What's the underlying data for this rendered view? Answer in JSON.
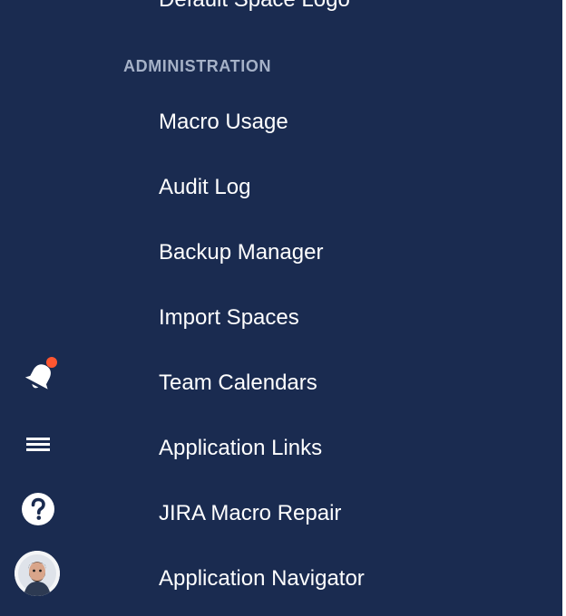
{
  "sidebar": {
    "partial_item_label": "Default Space Logo",
    "section_title": "ADMINISTRATION",
    "items": [
      {
        "label": "Macro Usage"
      },
      {
        "label": "Audit Log"
      },
      {
        "label": "Backup Manager"
      },
      {
        "label": "Import Spaces"
      },
      {
        "label": "Team Calendars"
      },
      {
        "label": "Application Links"
      },
      {
        "label": "JIRA Macro Repair"
      },
      {
        "label": "Application Navigator"
      }
    ]
  },
  "global_nav": {
    "icons": [
      "notification-bell-icon",
      "menu-icon",
      "help-icon",
      "user-avatar"
    ],
    "has_unread_notifications": true,
    "notification_dot_color": "#ff5630"
  },
  "theme": {
    "nav_background": "#1a2b50",
    "section_title_color": "#a5b1c7",
    "text_color": "#ffffff"
  }
}
